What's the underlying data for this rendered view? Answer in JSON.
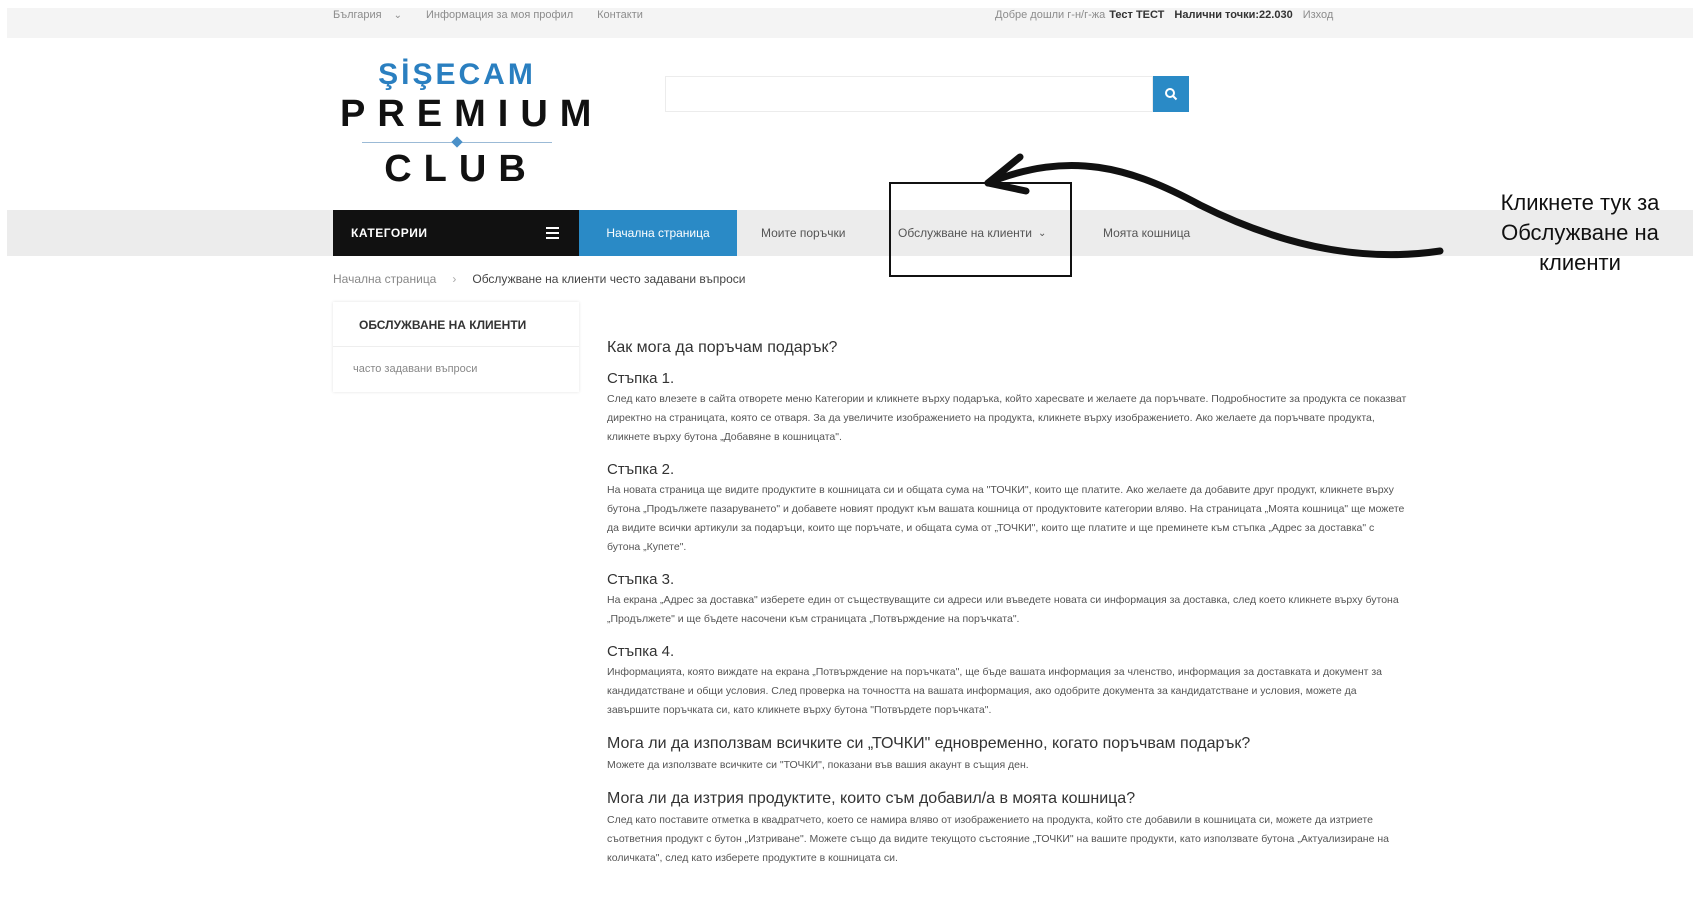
{
  "topbar": {
    "language": "България",
    "profile_link": "Информация за моя профил",
    "contacts_link": "Контакти",
    "welcome_prefix": "Добре дошли г-н/г-жа",
    "user_name": "Тест ТЕСТ",
    "points_label": "Налични точки:22.030",
    "logout_link": "Изход"
  },
  "logo": {
    "brand": "ŞİŞECAM",
    "line1": "PREMIUM",
    "line2": "CLUB"
  },
  "search": {
    "placeholder": ""
  },
  "nav": {
    "categories": "КАТЕГОРИИ",
    "home": "Начална страница",
    "orders": "Моите поръчки",
    "customer_service": "Обслужване на клиенти",
    "cart": "Моята кошница"
  },
  "annotation": {
    "line1": "Кликнете тук за",
    "line2": "Обслужване на",
    "line3": "клиенти"
  },
  "breadcrumb": {
    "home": "Начална страница",
    "current": "Обслужване на клиенти често задавани въпроси"
  },
  "sidebar": {
    "title": "ОБСЛУЖВАНЕ НА КЛИЕНТИ",
    "item": "часто задавани въпроси"
  },
  "faq": {
    "q1": "Как мога да поръчам подарък?",
    "step1_title": "Стъпка 1.",
    "step1_text": "След като влезете в сайта отворете меню Категории и кликнете върху подаръка, който харесвате и желаете да поръчвате. Подробностите за продукта се показват директно на страницата, която се отваря. За да увеличите изображението на продукта, кликнете върху изображението. Ако желаете да поръчвате продукта, кликнете върху бутона „Добавяне в кошницата\".",
    "step2_title": "Стъпка 2.",
    "step2_text": "На новата страница ще видите продуктите в кошницата си и общата сума на \"ТОЧКИ\", които ще платите. Ако желаете да добавите друг продукт, кликнете върху бутона „Продължете пазаруването\" и добавете новият продукт към вашата кошница от продуктовите категории вляво. На страницата „Моята кошница\" ще можете да видите всички артикули за подаръци, които ще поръчате, и общата сума от „ТОЧКИ\", които ще платите и ще преминете към стъпка „Адрес за доставка\" с бутона „Купете\".",
    "step3_title": "Стъпка 3.",
    "step3_text": "На екрана „Адрес за доставка\" изберете един от съществуващите си адреси или въведете новата си информация за доставка, след което кликнете върху бутона „Продължете\" и ще бъдете насочени към страницата „Потвърждение на поръчката\".",
    "step4_title": "Стъпка 4.",
    "step4_text": "Информацията, която виждате на екрана „Потвърждение на поръчката\", ще бъде вашата информация за членство, информация за доставката и документ за кандидатстване и общи условия. След проверка на точността на вашата информация, ако одобрите документа за кандидатстване и условия, можете да завършите поръчката си, като кликнете върху бутона \"Потвърдете поръчката\".",
    "q2": "Мога ли да използвам всичките си „ТОЧКИ\" едновременно, когато поръчвам подарък?",
    "a2": "Можете да използвате всичките си \"ТОЧКИ\", показани във вашия акаунт в същия ден.",
    "q3": "Мога ли да изтрия продуктите, които съм добавил/а в моята кошница?",
    "a3": "След като поставите отметка в квадратчето, което се намира вляво от изображението на продукта, който сте добавили в кошницата си, можете да изтриете съответния продукт с бутон „Изтриване\". Можете също да видите текущото състояние „ТОЧКИ\" на вашите продукти, като използвате бутона „Актуализиране на количката\", след като изберете продуктите в кошницата си."
  }
}
